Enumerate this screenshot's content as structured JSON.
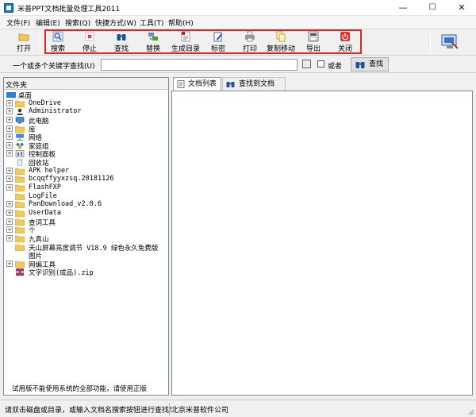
{
  "window": {
    "title": "米普PPT文档批量处理工具2011",
    "min": "—",
    "max": "☐",
    "close": "✕"
  },
  "menu": [
    {
      "label": "文件(F)"
    },
    {
      "label": "编辑(E)"
    },
    {
      "label": "搜索(Q)"
    },
    {
      "label": "快捷方式(W)"
    },
    {
      "label": "工具(T)"
    },
    {
      "label": "帮助(H)"
    }
  ],
  "toolbar": {
    "open": "打开",
    "search": "搜索",
    "stop": "停止",
    "find": "查找",
    "replace": "替换",
    "gen_dir": "生成目录",
    "mark_secret": "标密",
    "print": "打印",
    "copy_move": "复制移动",
    "export": "导出",
    "close": "关闭"
  },
  "search_row": {
    "label": "一个或多个关键字查找(U)",
    "value": "",
    "or_label": "或者",
    "find_button": "查找"
  },
  "left_panel": {
    "header": "文件夹",
    "root": "桌面",
    "items": [
      {
        "label": "OneDrive",
        "icon": "folder",
        "expand": "+"
      },
      {
        "label": "Administrator",
        "icon": "user",
        "expand": "+"
      },
      {
        "label": "此电脑",
        "icon": "computer",
        "expand": "+"
      },
      {
        "label": "库",
        "icon": "folder",
        "expand": "+"
      },
      {
        "label": "网络",
        "icon": "network",
        "expand": "+"
      },
      {
        "label": "家庭组",
        "icon": "homegroup",
        "expand": "+"
      },
      {
        "label": "控制面板",
        "icon": "control-panel",
        "expand": "+"
      },
      {
        "label": "回收站",
        "icon": "recycle-bin",
        "expand": ""
      },
      {
        "label": "APK helper",
        "icon": "folder",
        "expand": "+"
      },
      {
        "label": "bcqqffyyxzsq.20181126",
        "icon": "folder",
        "expand": "+"
      },
      {
        "label": "FlashFXP",
        "icon": "folder",
        "expand": "+"
      },
      {
        "label": "LogFile",
        "icon": "folder",
        "expand": ""
      },
      {
        "label": "PanDownload_v2.0.6",
        "icon": "folder",
        "expand": "+"
      },
      {
        "label": "UserData",
        "icon": "folder",
        "expand": "+"
      },
      {
        "label": "查词工具",
        "icon": "folder",
        "expand": "+"
      },
      {
        "label": "个",
        "icon": "folder",
        "expand": "+"
      },
      {
        "label": "九真山",
        "icon": "folder",
        "expand": "+"
      },
      {
        "label": "天山屏幕亮度调节 V18.9 绿色永久免费版",
        "icon": "folder",
        "expand": ""
      },
      {
        "label": "图片",
        "icon": "none",
        "expand": ""
      },
      {
        "label": "网编工具",
        "icon": "folder",
        "expand": "+"
      },
      {
        "label": "文字识别(成品).zip",
        "icon": "zip",
        "expand": ""
      }
    ],
    "notice": "试用版不能使用系统的全部功能，请使用正版"
  },
  "tabs": [
    {
      "label": "文档列表"
    },
    {
      "label": "查找到文档"
    }
  ],
  "status": {
    "left": "请双击磁盘或目录，或输入文档名搜索按钮进行查找！",
    "right": "北京米普软件公司"
  },
  "colors": {
    "highlight": "#d42a2a",
    "folder": "#f3c85a",
    "accent": "#0d73c9"
  }
}
